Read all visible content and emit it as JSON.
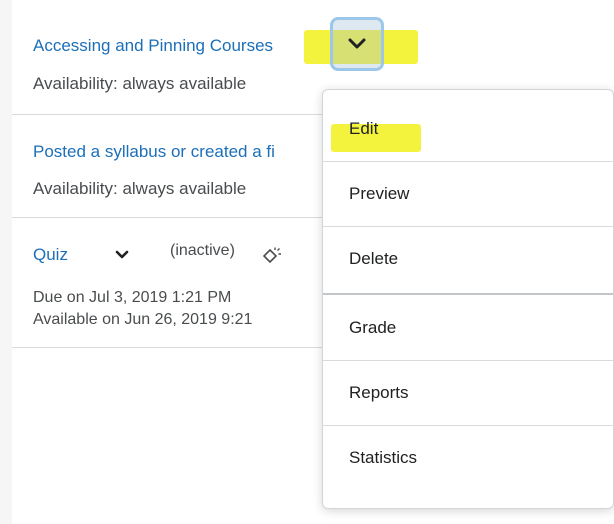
{
  "items": [
    {
      "title": "Accessing and Pinning Courses",
      "availability": "Availability: always available"
    },
    {
      "title": "Posted a syllabus or created a fi",
      "availability": "Availability: always available"
    },
    {
      "title": "Quiz",
      "status": "(inactive)",
      "due": "Due on Jul 3, 2019 1:21 PM",
      "available": "Available on Jun 26, 2019 9:21"
    }
  ],
  "menu": {
    "items": [
      "Edit",
      "Preview",
      "Delete",
      "Grade",
      "Reports",
      "Statistics"
    ]
  },
  "colors": {
    "link": "#1c6fb8",
    "highlight": "#f1f11c",
    "focus_ring": "#9cc7ea",
    "text": "#494c4e"
  },
  "icons": {
    "dropdown": "chevron-down-icon",
    "visibility": "hidden-visibility-icon"
  }
}
